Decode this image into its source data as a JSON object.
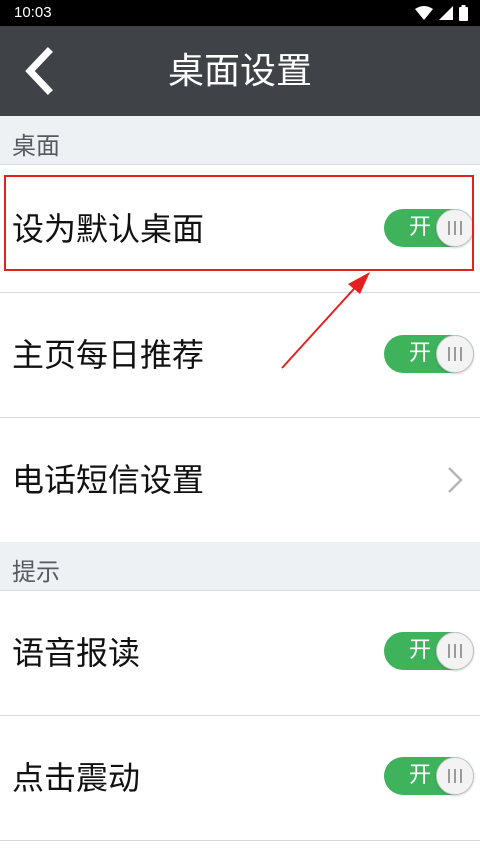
{
  "status_bar": {
    "time": "10:03"
  },
  "header": {
    "title": "桌面设置"
  },
  "sections": [
    {
      "title": "桌面"
    },
    {
      "title": "提示"
    }
  ],
  "rows": [
    {
      "label": "设为默认桌面",
      "control": "toggle",
      "toggle_label": "开",
      "checked": true
    },
    {
      "label": "主页每日推荐",
      "control": "toggle",
      "toggle_label": "开",
      "checked": true
    },
    {
      "label": "电话短信设置",
      "control": "chevron"
    },
    {
      "label": "语音报读",
      "control": "toggle",
      "toggle_label": "开",
      "checked": true
    },
    {
      "label": "点击震动",
      "control": "toggle",
      "toggle_label": "开",
      "checked": true
    }
  ],
  "colors": {
    "title_bar": "#3f4348",
    "toggle_on": "#3eb35b",
    "section_bg": "#eef1f3",
    "annotation": "#e42020"
  }
}
